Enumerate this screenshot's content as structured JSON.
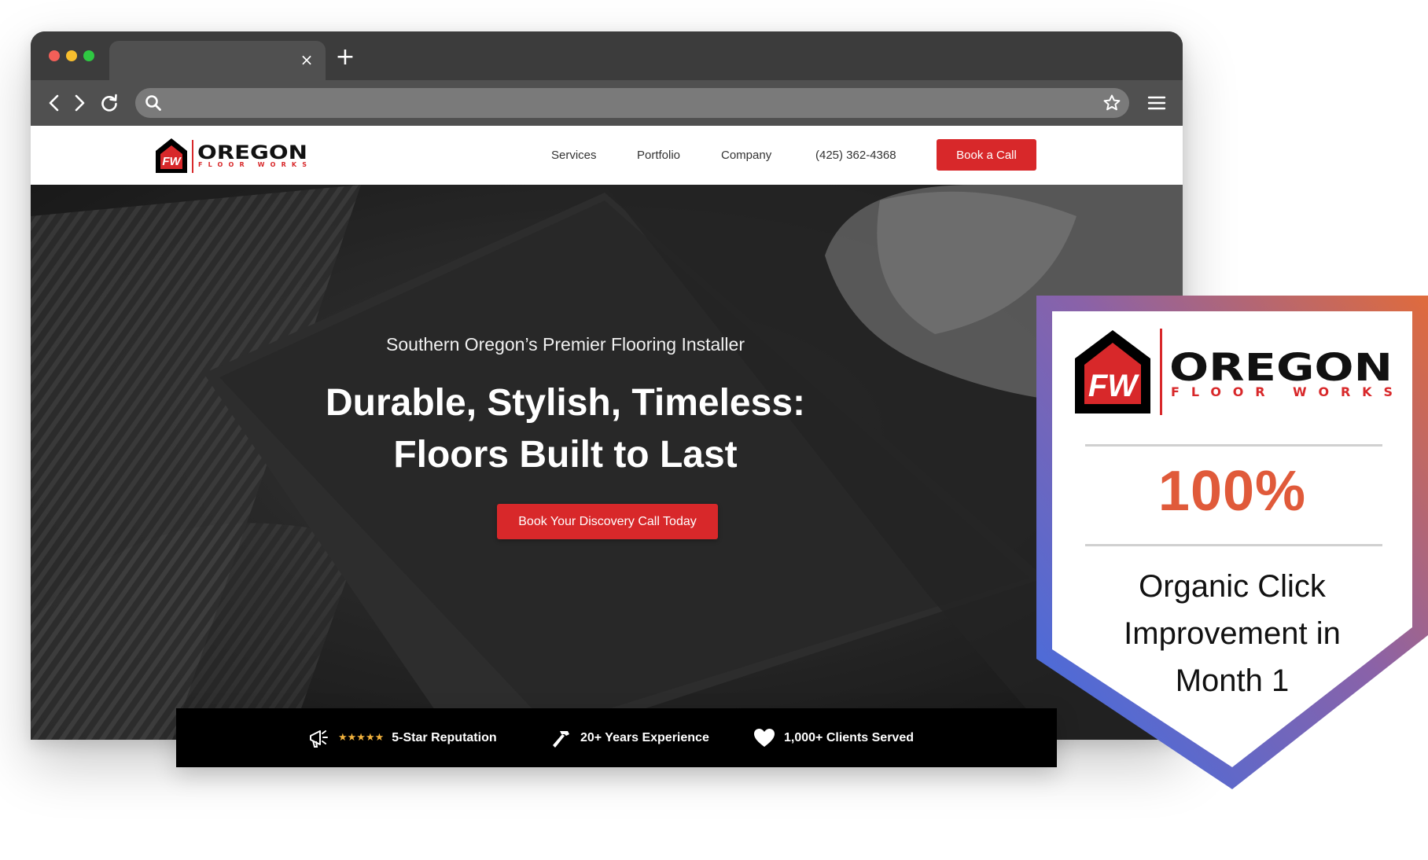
{
  "browser": {
    "tab_close": "×",
    "new_tab": "+",
    "icons": [
      "back-icon",
      "forward-icon",
      "reload-icon",
      "search-icon",
      "star-icon",
      "menu-icon"
    ]
  },
  "site": {
    "logo": {
      "monogram": "FW",
      "name": "OREGON",
      "tagline": "FLOOR WORKS"
    },
    "nav": [
      "Services",
      "Portfolio",
      "Company",
      "(425) 362-4368"
    ],
    "cta_button": "Book a Call"
  },
  "hero": {
    "subtitle": "Southern Oregon’s Premier Flooring Installer",
    "title_line1": "Durable, Stylish, Timeless:",
    "title_line2": "Floors Built to Last",
    "button": "Book Your Discovery Call Today"
  },
  "stats": [
    {
      "icon": "megaphone-icon",
      "stars": "★★★★★",
      "label": "5-Star Reputation"
    },
    {
      "icon": "hammer-icon",
      "label": "20+ Years Experience"
    },
    {
      "icon": "heart-icon",
      "label": "1,000+ Clients Served"
    }
  ],
  "badge": {
    "logo": {
      "monogram": "FW",
      "name": "OREGON",
      "tagline": "FLOOR WORKS"
    },
    "stat": "100%",
    "caption_line1": "Organic Click",
    "caption_line2": "Improvement in",
    "caption_line3": "Month 1"
  },
  "colors": {
    "brand_red": "#d8282a",
    "stat_orange": "#e05a3a",
    "badge_gradient": [
      "#3b6ee6",
      "#e06b3c"
    ],
    "stars": "#f3b33d"
  }
}
